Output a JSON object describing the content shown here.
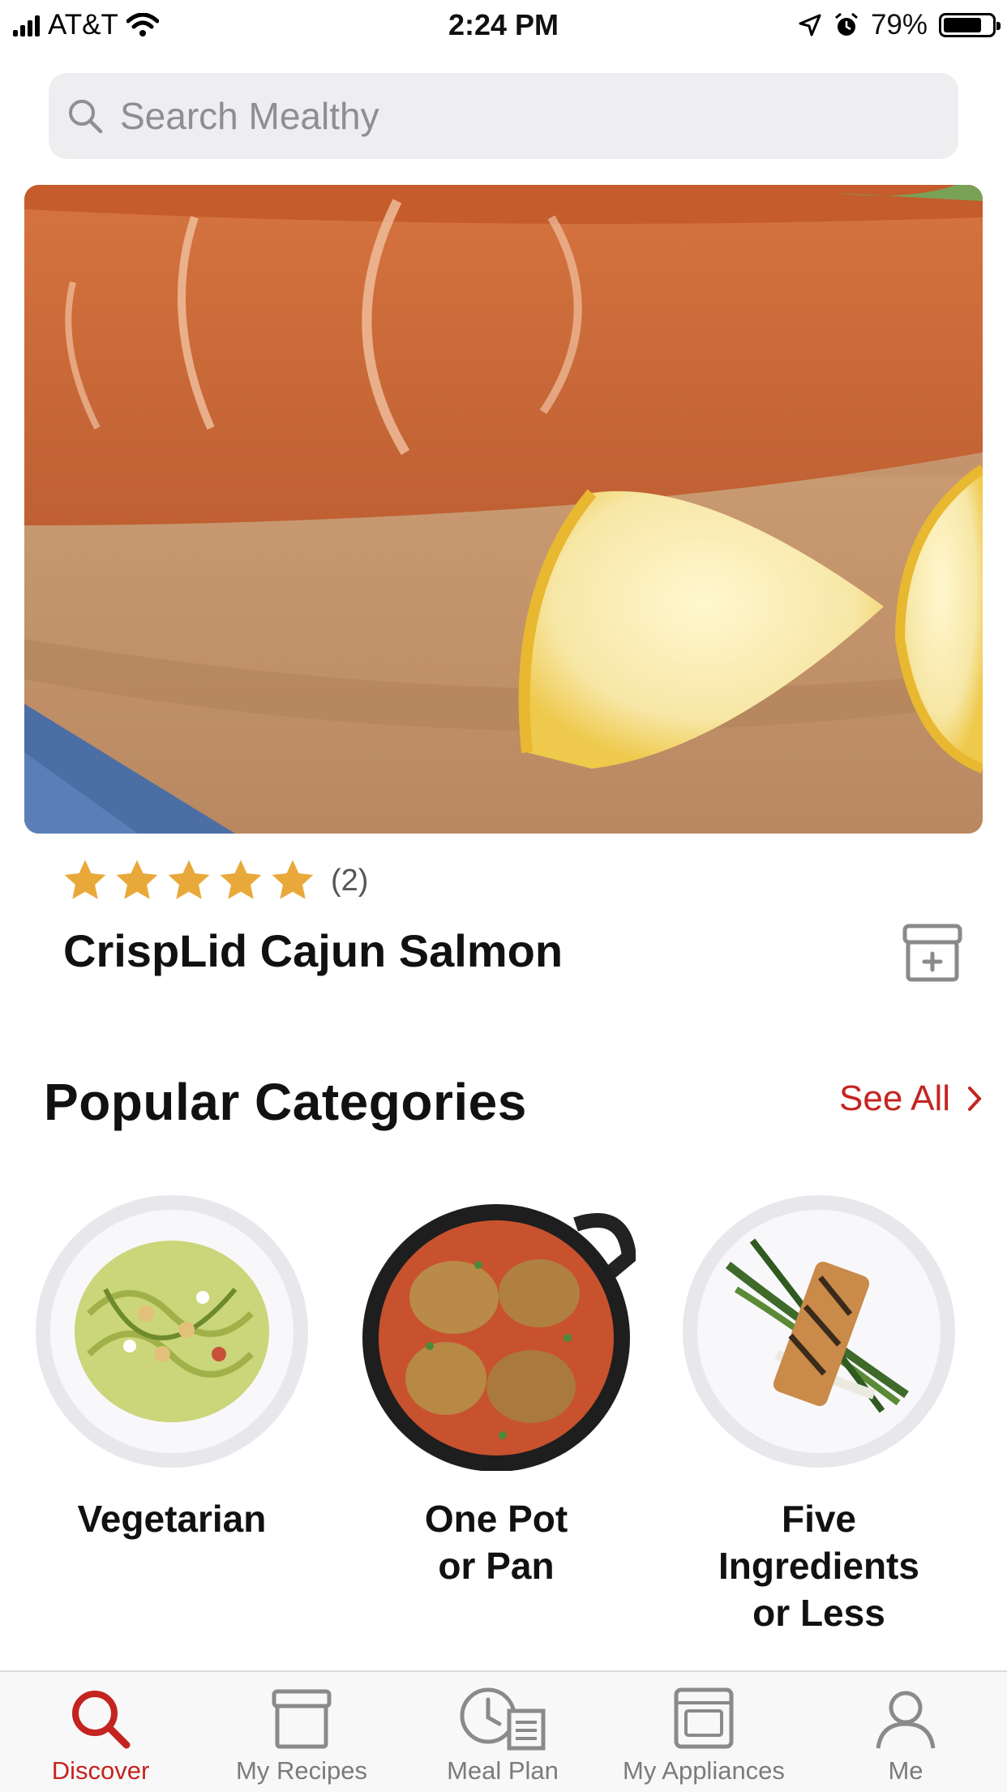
{
  "status_bar": {
    "carrier": "AT&T",
    "time": "2:24 PM",
    "battery": "79%",
    "battery_level": 0.79
  },
  "search": {
    "placeholder": "Search Mealthy"
  },
  "featured": {
    "rating_stars": 5,
    "rating_count": "(2)",
    "title": "CrispLid Cajun Salmon"
  },
  "popular": {
    "title": "Popular Categories",
    "see_all": "See All",
    "categories": [
      {
        "label": "Vegetarian"
      },
      {
        "label": "One Pot\nor Pan"
      },
      {
        "label": "Five\nIngredients\nor Less"
      }
    ]
  },
  "tabs": [
    {
      "label": "Discover",
      "icon": "search-icon"
    },
    {
      "label": "My Recipes",
      "icon": "recipe-box-icon"
    },
    {
      "label": "Meal Plan",
      "icon": "meal-plan-icon"
    },
    {
      "label": "My Appliances",
      "icon": "appliance-icon"
    },
    {
      "label": "Me",
      "icon": "person-icon"
    }
  ],
  "colors": {
    "accent": "#c42420",
    "star": "#e9a93a"
  }
}
